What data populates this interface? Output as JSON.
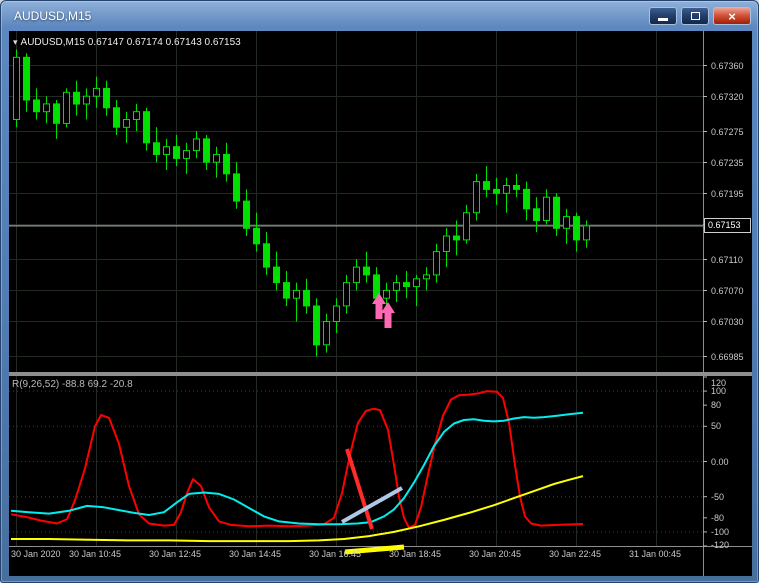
{
  "window": {
    "title": "AUDUSD,M15",
    "controls": [
      {
        "name": "minimize",
        "glyph": ""
      },
      {
        "name": "restore",
        "glyph": ""
      },
      {
        "name": "close",
        "glyph": "×"
      }
    ]
  },
  "main_chart": {
    "dropdown_glyph": "▾",
    "info": "AUDUSD,M15 0.67147 0.67174 0.67143 0.67153",
    "current_price": "0.67153"
  },
  "indicator_panel": {
    "label": "R(9,26,52) -88.8 69.2 -20.8"
  },
  "chart_data": {
    "type": "candlestick",
    "symbol": "AUDUSD",
    "timeframe": "M15",
    "title": "AUDUSD,M15",
    "ohlc_info": {
      "open": "0.67147",
      "high": "0.67174",
      "low": "0.67143",
      "close": "0.67153"
    },
    "bar_spacing": 10,
    "colors": {
      "background": "#000000",
      "grid": "#232a23",
      "candle": "#00E000",
      "current_price_line": "#c0c0c0",
      "arrow": "#FF69B4",
      "titlebar": "#5d88bf"
    },
    "price_axis": {
      "range": [
        0.66965,
        0.674
      ],
      "current_price": 0.67153,
      "gridlines": [
        {
          "price": 0.6736,
          "label": "0.67360"
        },
        {
          "price": 0.6732,
          "label": "0.67320"
        },
        {
          "price": 0.67275,
          "label": "0.67275"
        },
        {
          "price": 0.67235,
          "label": "0.67235"
        },
        {
          "price": 0.67195,
          "label": "0.67195"
        },
        {
          "price": 0.67155,
          "label": ""
        },
        {
          "price": 0.6711,
          "label": "0.67110"
        },
        {
          "price": 0.6707,
          "label": "0.67070"
        },
        {
          "price": 0.6703,
          "label": "0.67030"
        },
        {
          "price": 0.66985,
          "label": "0.66985"
        }
      ]
    },
    "time_axis": [
      {
        "label": "30 Jan 2020",
        "bar": 0
      },
      {
        "label": "30 Jan 10:45",
        "bar": 8
      },
      {
        "label": "30 Jan 12:45",
        "bar": 16
      },
      {
        "label": "30 Jan 14:45",
        "bar": 24
      },
      {
        "label": "30 Jan 16:45",
        "bar": 32
      },
      {
        "label": "30 Jan 18:45",
        "bar": 40
      },
      {
        "label": "30 Jan 20:45",
        "bar": 48
      },
      {
        "label": "30 Jan 22:45",
        "bar": 56
      },
      {
        "label": "31 Jan 00:45",
        "bar": 64
      }
    ],
    "candles": [
      [
        0.6729,
        0.6738,
        0.6728,
        0.6737
      ],
      [
        0.6737,
        0.67375,
        0.673,
        0.67315
      ],
      [
        0.67315,
        0.6733,
        0.6729,
        0.673
      ],
      [
        0.673,
        0.6732,
        0.67285,
        0.6731
      ],
      [
        0.6731,
        0.67315,
        0.67265,
        0.67285
      ],
      [
        0.67285,
        0.6733,
        0.6728,
        0.67325
      ],
      [
        0.67325,
        0.6734,
        0.67295,
        0.6731
      ],
      [
        0.6731,
        0.6733,
        0.6729,
        0.6732
      ],
      [
        0.6732,
        0.67345,
        0.67305,
        0.6733
      ],
      [
        0.6733,
        0.6734,
        0.67295,
        0.67305
      ],
      [
        0.67305,
        0.67315,
        0.6727,
        0.6728
      ],
      [
        0.6728,
        0.673,
        0.6726,
        0.6729
      ],
      [
        0.6729,
        0.6731,
        0.67275,
        0.673
      ],
      [
        0.673,
        0.67305,
        0.6725,
        0.6726
      ],
      [
        0.6726,
        0.6728,
        0.67235,
        0.67245
      ],
      [
        0.67245,
        0.67265,
        0.67225,
        0.67255
      ],
      [
        0.67255,
        0.6727,
        0.6723,
        0.6724
      ],
      [
        0.6724,
        0.6726,
        0.6722,
        0.6725
      ],
      [
        0.6725,
        0.67275,
        0.6724,
        0.67265
      ],
      [
        0.67265,
        0.6727,
        0.67225,
        0.67235
      ],
      [
        0.67235,
        0.67255,
        0.67215,
        0.67245
      ],
      [
        0.67245,
        0.6726,
        0.6721,
        0.6722
      ],
      [
        0.6722,
        0.67235,
        0.67175,
        0.67185
      ],
      [
        0.67185,
        0.672,
        0.6714,
        0.6715
      ],
      [
        0.6715,
        0.6717,
        0.6712,
        0.6713
      ],
      [
        0.6713,
        0.67145,
        0.6709,
        0.671
      ],
      [
        0.671,
        0.6712,
        0.6707,
        0.6708
      ],
      [
        0.6708,
        0.67095,
        0.6705,
        0.6706
      ],
      [
        0.6706,
        0.6708,
        0.6703,
        0.6707
      ],
      [
        0.6707,
        0.67085,
        0.6704,
        0.6705
      ],
      [
        0.6705,
        0.6706,
        0.66985,
        0.67
      ],
      [
        0.67,
        0.6704,
        0.6699,
        0.6703
      ],
      [
        0.6703,
        0.6706,
        0.67015,
        0.6705
      ],
      [
        0.6705,
        0.6709,
        0.6704,
        0.6708
      ],
      [
        0.6708,
        0.6711,
        0.6707,
        0.671
      ],
      [
        0.671,
        0.6712,
        0.6708,
        0.6709
      ],
      [
        0.6709,
        0.671,
        0.6705,
        0.6706
      ],
      [
        0.6706,
        0.6708,
        0.67035,
        0.6707
      ],
      [
        0.6707,
        0.6709,
        0.67055,
        0.6708
      ],
      [
        0.6708,
        0.67095,
        0.6706,
        0.67075
      ],
      [
        0.67075,
        0.6709,
        0.6705,
        0.67085
      ],
      [
        0.67085,
        0.671,
        0.6707,
        0.6709
      ],
      [
        0.6709,
        0.6713,
        0.6708,
        0.6712
      ],
      [
        0.6712,
        0.6715,
        0.671,
        0.6714
      ],
      [
        0.6714,
        0.6716,
        0.67115,
        0.67135
      ],
      [
        0.67135,
        0.6718,
        0.6713,
        0.6717
      ],
      [
        0.6717,
        0.6722,
        0.6716,
        0.6721
      ],
      [
        0.6721,
        0.6723,
        0.6719,
        0.672
      ],
      [
        0.672,
        0.67215,
        0.6718,
        0.67195
      ],
      [
        0.67195,
        0.67215,
        0.6717,
        0.67205
      ],
      [
        0.67205,
        0.6722,
        0.6719,
        0.672
      ],
      [
        0.672,
        0.6721,
        0.6716,
        0.67175
      ],
      [
        0.67175,
        0.6719,
        0.67145,
        0.6716
      ],
      [
        0.6716,
        0.672,
        0.67155,
        0.6719
      ],
      [
        0.6719,
        0.67195,
        0.6714,
        0.6715
      ],
      [
        0.6715,
        0.67175,
        0.6713,
        0.67165
      ],
      [
        0.67165,
        0.6717,
        0.6712,
        0.67135
      ],
      [
        0.67135,
        0.6716,
        0.67125,
        0.67153
      ]
    ],
    "indicator": {
      "name": "R(9,26,52)",
      "current_values": [
        "-88.8",
        "69.2",
        "-20.8"
      ],
      "range": [
        -120,
        120
      ],
      "levels": [
        100,
        50,
        0,
        -50,
        -100
      ],
      "axis_labels": [
        {
          "v": 120,
          "t": "120"
        },
        {
          "v": 100,
          "t": "100"
        },
        {
          "v": 80,
          "t": "80"
        },
        {
          "v": 50,
          "t": "50"
        },
        {
          "v": 0,
          "t": "0.00"
        },
        {
          "v": -50,
          "t": "-50"
        },
        {
          "v": -80,
          "t": "-80"
        },
        {
          "v": -100,
          "t": "-100"
        },
        {
          "v": -120,
          "t": "-120"
        }
      ],
      "series": [
        {
          "name": "fast-red",
          "color": "#FF0000",
          "width": 2,
          "points": [
            [
              2,
              -75
            ],
            [
              18,
              -79
            ],
            [
              32,
              -84
            ],
            [
              48,
              -88
            ],
            [
              58,
              -82
            ],
            [
              66,
              -55
            ],
            [
              76,
              -10
            ],
            [
              86,
              50
            ],
            [
              92,
              66
            ],
            [
              100,
              62
            ],
            [
              110,
              25
            ],
            [
              120,
              -35
            ],
            [
              130,
              -75
            ],
            [
              140,
              -88
            ],
            [
              155,
              -91
            ],
            [
              165,
              -90
            ],
            [
              172,
              -72
            ],
            [
              178,
              -45
            ],
            [
              184,
              -25
            ],
            [
              192,
              -35
            ],
            [
              200,
              -65
            ],
            [
              210,
              -85
            ],
            [
              222,
              -90
            ],
            [
              240,
              -92
            ],
            [
              260,
              -91
            ],
            [
              280,
              -92
            ],
            [
              300,
              -91
            ],
            [
              315,
              -89
            ],
            [
              325,
              -80
            ],
            [
              333,
              -45
            ],
            [
              341,
              10
            ],
            [
              349,
              55
            ],
            [
              357,
              72
            ],
            [
              365,
              75
            ],
            [
              371,
              73
            ],
            [
              379,
              45
            ],
            [
              385,
              -5
            ],
            [
              390,
              -50
            ],
            [
              395,
              -80
            ],
            [
              400,
              -94
            ],
            [
              406,
              -90
            ],
            [
              412,
              -65
            ],
            [
              418,
              -25
            ],
            [
              426,
              25
            ],
            [
              434,
              65
            ],
            [
              442,
              88
            ],
            [
              450,
              94
            ],
            [
              460,
              95
            ],
            [
              470,
              97
            ],
            [
              478,
              100
            ],
            [
              488,
              99
            ],
            [
              494,
              90
            ],
            [
              500,
              55
            ],
            [
              506,
              -5
            ],
            [
              511,
              -50
            ],
            [
              516,
              -78
            ],
            [
              522,
              -88
            ],
            [
              532,
              -91
            ],
            [
              548,
              -90
            ],
            [
              574,
              -88.8
            ]
          ]
        },
        {
          "name": "mid-cyan",
          "color": "#00EEEE",
          "width": 2,
          "points": [
            [
              2,
              -70
            ],
            [
              20,
              -72
            ],
            [
              40,
              -74
            ],
            [
              60,
              -70
            ],
            [
              78,
              -63
            ],
            [
              95,
              -65
            ],
            [
              110,
              -69
            ],
            [
              125,
              -73
            ],
            [
              140,
              -76
            ],
            [
              155,
              -72
            ],
            [
              168,
              -58
            ],
            [
              180,
              -46
            ],
            [
              195,
              -44
            ],
            [
              210,
              -46
            ],
            [
              225,
              -54
            ],
            [
              240,
              -66
            ],
            [
              255,
              -78
            ],
            [
              270,
              -85
            ],
            [
              290,
              -88
            ],
            [
              310,
              -89
            ],
            [
              330,
              -89
            ],
            [
              348,
              -88
            ],
            [
              362,
              -86
            ],
            [
              375,
              -78
            ],
            [
              385,
              -68
            ],
            [
              395,
              -52
            ],
            [
              405,
              -30
            ],
            [
              415,
              -5
            ],
            [
              425,
              22
            ],
            [
              435,
              42
            ],
            [
              445,
              54
            ],
            [
              455,
              59
            ],
            [
              465,
              60
            ],
            [
              475,
              58
            ],
            [
              485,
              57
            ],
            [
              495,
              58
            ],
            [
              505,
              61
            ],
            [
              515,
              63
            ],
            [
              525,
              62
            ],
            [
              535,
              63
            ],
            [
              548,
              65
            ],
            [
              560,
              67
            ],
            [
              574,
              69.2
            ]
          ]
        },
        {
          "name": "slow-yellow",
          "color": "#FFFF00",
          "width": 2,
          "points": [
            [
              2,
              -110
            ],
            [
              40,
              -110
            ],
            [
              80,
              -111
            ],
            [
              120,
              -112
            ],
            [
              160,
              -112
            ],
            [
              200,
              -113
            ],
            [
              240,
              -113
            ],
            [
              280,
              -113
            ],
            [
              310,
              -112
            ],
            [
              335,
              -110
            ],
            [
              360,
              -106
            ],
            [
              385,
              -100
            ],
            [
              410,
              -92
            ],
            [
              435,
              -83
            ],
            [
              460,
              -73
            ],
            [
              485,
              -62
            ],
            [
              505,
              -52
            ],
            [
              525,
              -42
            ],
            [
              545,
              -32
            ],
            [
              560,
              -26
            ],
            [
              574,
              -20.8
            ]
          ]
        }
      ]
    },
    "objects": [
      {
        "type": "segment",
        "name": "red-trendline",
        "color": "#FF2A2A",
        "width": 4,
        "from": [
          338,
          418
        ],
        "to": [
          363,
          498
        ]
      },
      {
        "type": "segment",
        "name": "steel-trendline",
        "color": "#AFC8E6",
        "width": 4,
        "from": [
          333,
          491
        ],
        "to": [
          393,
          457
        ]
      },
      {
        "type": "segment",
        "name": "yellow-trendline",
        "color": "#FFFF00",
        "width": 5,
        "from": [
          336,
          521
        ],
        "to": [
          395,
          516
        ]
      },
      {
        "type": "arrow-up",
        "name": "buy-arrow",
        "color": "#FF69B4",
        "tip": [
          370,
          262
        ]
      },
      {
        "type": "arrow-up",
        "name": "buy-arrow",
        "color": "#FF69B4",
        "tip": [
          379,
          271
        ]
      }
    ]
  }
}
